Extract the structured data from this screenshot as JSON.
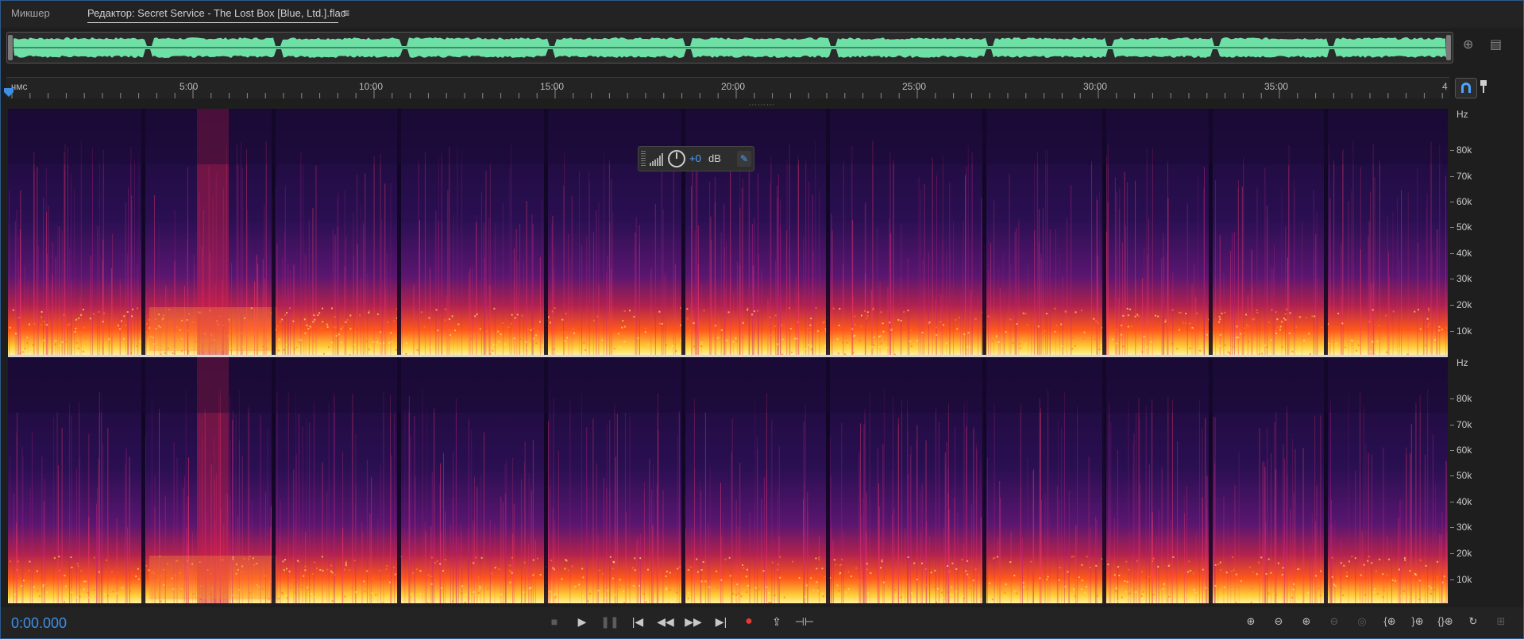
{
  "tabs": {
    "mixer": "Микшер",
    "editor": "Редактор: Secret Service - The Lost Box [Blue, Ltd.].flac"
  },
  "ruler": {
    "unit_label": "чмс",
    "marks": [
      "5:00",
      "10:00",
      "15:00",
      "20:00",
      "25:00",
      "30:00",
      "35:00",
      "4"
    ]
  },
  "frequency_scale": {
    "unit": "Hz",
    "labels": [
      "80k",
      "70k",
      "60k",
      "50k",
      "40k",
      "30k",
      "20k",
      "10k"
    ]
  },
  "hud": {
    "volume_value": "+0",
    "volume_unit": "dB"
  },
  "transport": {
    "timecode": "0:00.000"
  },
  "colors": {
    "waveform": "#6ee0a6",
    "accent": "#3d8ee6",
    "record": "#e53935"
  },
  "icons": {
    "tab_menu": "hamburger-icon",
    "overview_zoom": "zoom-icon",
    "overview_settings": "panel-icon",
    "snap": "magnet-icon",
    "pin": "pin-icon"
  }
}
